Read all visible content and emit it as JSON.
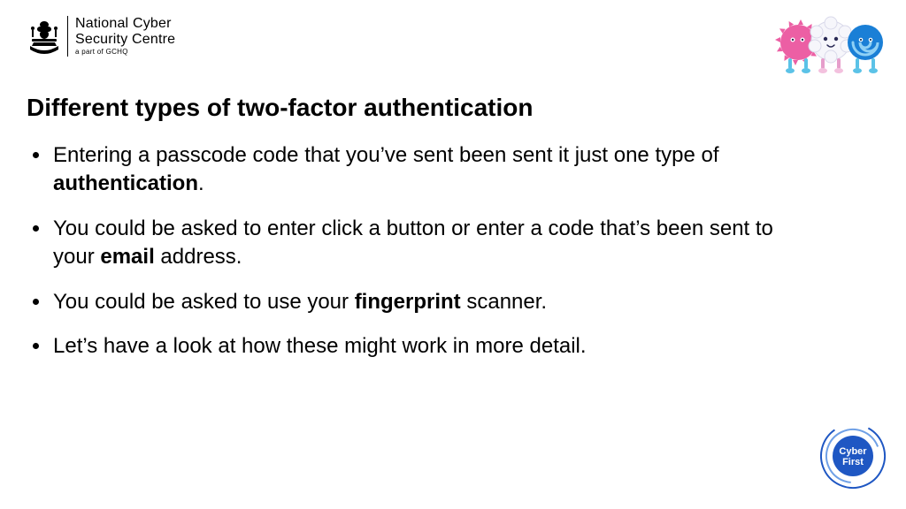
{
  "header": {
    "org_line1": "National Cyber",
    "org_line2": "Security Centre",
    "org_sub": "a part of GCHQ"
  },
  "title": "Different types of two-factor authentication",
  "bullets": [
    {
      "pre": "Entering a passcode code that you’ve sent been sent it just one type of ",
      "bold": "authentication",
      "post": "."
    },
    {
      "pre": "You could be asked to enter click a button or enter a code that’s been sent to your ",
      "bold": "email",
      "post": " address."
    },
    {
      "pre": "You could be asked to use your ",
      "bold": "fingerprint",
      "post": " scanner."
    },
    {
      "pre": "Let’s have a look at how these might work in more detail.",
      "bold": "",
      "post": ""
    }
  ],
  "badges": {
    "cyberfirst_line1": "Cyber",
    "cyberfirst_line2": "First"
  },
  "colors": {
    "mascot_pink": "#ec5fa4",
    "mascot_white": "#f6f6fb",
    "mascot_blue": "#1a7fd6",
    "cyberfirst_blue": "#1f57c3"
  }
}
